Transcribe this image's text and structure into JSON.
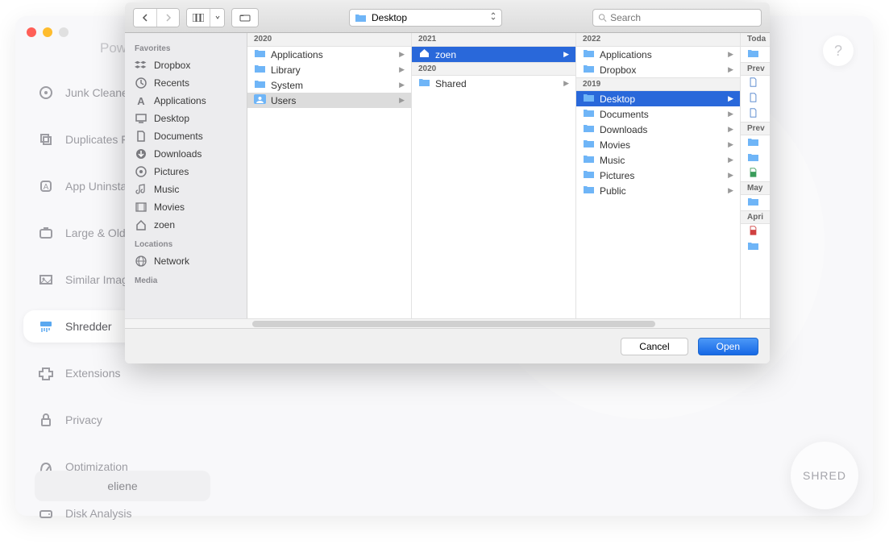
{
  "app": {
    "title": "Pow",
    "sidebar": [
      {
        "id": "junk",
        "label": "Junk Cleaner"
      },
      {
        "id": "dup",
        "label": "Duplicates Fin"
      },
      {
        "id": "uninstall",
        "label": "App Uninstalle"
      },
      {
        "id": "large",
        "label": "Large & Old Fil"
      },
      {
        "id": "similar",
        "label": "Similar Image"
      },
      {
        "id": "shredder",
        "label": "Shredder"
      },
      {
        "id": "ext",
        "label": "Extensions"
      },
      {
        "id": "privacy",
        "label": "Privacy"
      },
      {
        "id": "opt",
        "label": "Optimization"
      },
      {
        "id": "disk",
        "label": "Disk Analysis"
      }
    ],
    "active_sidebar": "shredder",
    "user": "eliene",
    "help": "?",
    "shred_button": "SHRED"
  },
  "finder": {
    "path_label": "Desktop",
    "search_placeholder": "Search",
    "sidebar": {
      "favorites_heading": "Favorites",
      "favorites": [
        {
          "id": "dropbox",
          "label": "Dropbox"
        },
        {
          "id": "recents",
          "label": "Recents"
        },
        {
          "id": "applications",
          "label": "Applications"
        },
        {
          "id": "desktop",
          "label": "Desktop"
        },
        {
          "id": "documents",
          "label": "Documents"
        },
        {
          "id": "downloads",
          "label": "Downloads"
        },
        {
          "id": "pictures",
          "label": "Pictures"
        },
        {
          "id": "music",
          "label": "Music"
        },
        {
          "id": "movies",
          "label": "Movies"
        },
        {
          "id": "zoen",
          "label": "zoen"
        }
      ],
      "locations_heading": "Locations",
      "locations": [
        {
          "id": "network",
          "label": "Network"
        }
      ],
      "media_heading": "Media"
    },
    "columns": [
      {
        "header": "2020",
        "items": [
          {
            "label": "Applications",
            "arrow": true,
            "icon": "folder"
          },
          {
            "label": "Library",
            "arrow": true,
            "icon": "folder"
          },
          {
            "label": "System",
            "arrow": true,
            "icon": "folder"
          },
          {
            "label": "Users",
            "arrow": true,
            "icon": "users",
            "sel": "grey"
          }
        ]
      },
      {
        "header": "2021",
        "items": [
          {
            "label": "zoen",
            "arrow": true,
            "icon": "home",
            "sel": "blue"
          },
          {
            "label": "2020",
            "arrow": false,
            "subheader": true
          },
          {
            "label": "Shared",
            "arrow": true,
            "icon": "folder"
          }
        ]
      },
      {
        "header": "2022",
        "items": [
          {
            "label": "Applications",
            "arrow": true,
            "icon": "folder"
          },
          {
            "label": "Dropbox",
            "arrow": true,
            "icon": "folder"
          },
          {
            "label": "2019",
            "arrow": false,
            "subheader": true
          },
          {
            "label": "Desktop",
            "arrow": true,
            "icon": "folder",
            "sel": "blue"
          },
          {
            "label": "Documents",
            "arrow": true,
            "icon": "folder"
          },
          {
            "label": "Downloads",
            "arrow": true,
            "icon": "folder"
          },
          {
            "label": "Movies",
            "arrow": true,
            "icon": "folder"
          },
          {
            "label": "Music",
            "arrow": true,
            "icon": "folder"
          },
          {
            "label": "Pictures",
            "arrow": true,
            "icon": "folder"
          },
          {
            "label": "Public",
            "arrow": true,
            "icon": "folder"
          }
        ]
      },
      {
        "header": "Toda",
        "items": [
          {
            "label": "",
            "icon": "folder"
          },
          {
            "label": "Prev",
            "subheader": true
          },
          {
            "label": "",
            "icon": "doc"
          },
          {
            "label": "",
            "icon": "doc"
          },
          {
            "label": "",
            "icon": "doc"
          },
          {
            "label": "Prev",
            "subheader": true
          },
          {
            "label": "",
            "icon": "folder"
          },
          {
            "label": "",
            "icon": "folder"
          },
          {
            "label": "",
            "icon": "xls"
          },
          {
            "label": "May",
            "subheader": true
          },
          {
            "label": "",
            "icon": "folder"
          },
          {
            "label": "Apri",
            "subheader": true
          },
          {
            "label": "",
            "icon": "pdf"
          },
          {
            "label": "",
            "icon": "folder"
          }
        ]
      }
    ],
    "cancel_label": "Cancel",
    "open_label": "Open"
  }
}
